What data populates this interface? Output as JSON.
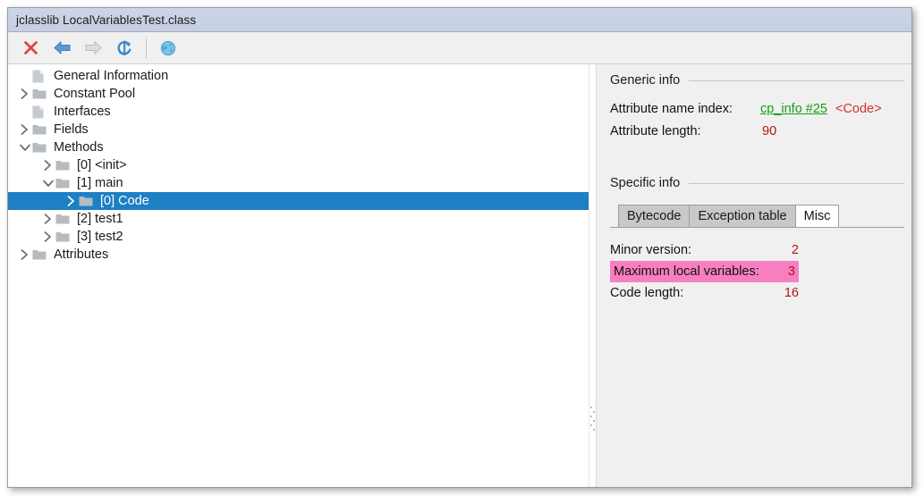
{
  "window": {
    "title": "jclasslib LocalVariablesTest.class"
  },
  "toolbar": {
    "items": [
      {
        "name": "close-icon",
        "label": "Close"
      },
      {
        "name": "back-arrow-icon",
        "label": "Back"
      },
      {
        "name": "forward-arrow-icon",
        "label": "Forward"
      },
      {
        "name": "reload-icon",
        "label": "Reload"
      },
      {
        "name": "browse-globe-icon",
        "label": "Browse"
      }
    ]
  },
  "tree": {
    "nodes": [
      {
        "label": "General Information",
        "indent": 0,
        "twisty": "none",
        "icon": "document-icon",
        "selected": false
      },
      {
        "label": "Constant Pool",
        "indent": 0,
        "twisty": "collapsed",
        "icon": "folder-icon",
        "selected": false
      },
      {
        "label": "Interfaces",
        "indent": 0,
        "twisty": "none",
        "icon": "document-icon",
        "selected": false
      },
      {
        "label": "Fields",
        "indent": 0,
        "twisty": "collapsed",
        "icon": "folder-icon",
        "selected": false
      },
      {
        "label": "Methods",
        "indent": 0,
        "twisty": "expanded",
        "icon": "folder-icon",
        "selected": false
      },
      {
        "label": "[0] <init>",
        "indent": 1,
        "twisty": "collapsed",
        "icon": "folder-icon",
        "selected": false
      },
      {
        "label": "[1] main",
        "indent": 1,
        "twisty": "expanded",
        "icon": "folder-icon",
        "selected": false
      },
      {
        "label": "[0] Code",
        "indent": 2,
        "twisty": "collapsed",
        "icon": "folder-icon",
        "selected": true
      },
      {
        "label": "[2] test1",
        "indent": 1,
        "twisty": "collapsed",
        "icon": "folder-icon",
        "selected": false
      },
      {
        "label": "[3] test2",
        "indent": 1,
        "twisty": "collapsed",
        "icon": "folder-icon",
        "selected": false
      },
      {
        "label": "Attributes",
        "indent": 0,
        "twisty": "collapsed",
        "icon": "folder-icon",
        "selected": false
      }
    ]
  },
  "generic_info": {
    "heading": "Generic info",
    "attribute_name_index_label": "Attribute name index:",
    "attribute_name_index_link": "cp_info #25",
    "attribute_name_index_extra": "<Code>",
    "attribute_length_label": "Attribute length:",
    "attribute_length_value": "90"
  },
  "specific_info": {
    "heading": "Specific info",
    "tabs": [
      {
        "label": "Bytecode",
        "active": false
      },
      {
        "label": "Exception table",
        "active": false
      },
      {
        "label": "Misc",
        "active": true
      }
    ],
    "misc": [
      {
        "key": "Minor version:",
        "value": "2",
        "highlight": false
      },
      {
        "key": "Maximum local variables:",
        "value": "3",
        "highlight": true
      },
      {
        "key": "Code length:",
        "value": "16",
        "highlight": false
      }
    ]
  },
  "colors": {
    "titlebar": "#ccd4e8",
    "selection": "#1d7fc4",
    "highlight": "#f77fc0",
    "value_red": "#b01515",
    "link_green": "#12a012",
    "panel_bg": "#f0f0f0"
  }
}
